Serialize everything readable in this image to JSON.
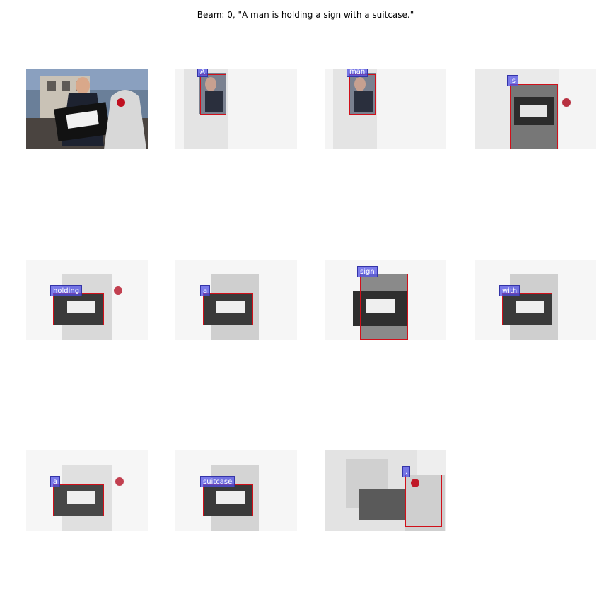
{
  "title": "Beam: 0, \"A man is holding a sign with a suitcase.\"",
  "original_image": "photo of man holding briefcase with sign",
  "panels": [
    {
      "word": "A"
    },
    {
      "word": "man"
    },
    {
      "word": "is"
    },
    {
      "word": "holding"
    },
    {
      "word": "a"
    },
    {
      "word": "sign"
    },
    {
      "word": "with"
    },
    {
      "word": "a"
    },
    {
      "word": "suitcase"
    },
    {
      "word": "."
    }
  ],
  "colors": {
    "box": "#d0101a",
    "tag": "#5050e6"
  }
}
